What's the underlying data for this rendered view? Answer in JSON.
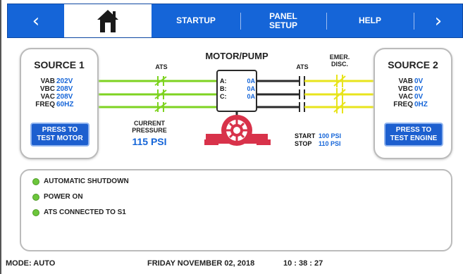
{
  "nav": {
    "back_arrow": "‹",
    "home_icon": "home-icon",
    "startup": "STARTUP",
    "panel_setup_line1": "PANEL",
    "panel_setup_line2": "SETUP",
    "help": "HELP",
    "forward_arrow": "›"
  },
  "source1": {
    "title": "SOURCE 1",
    "readings": [
      {
        "label": "VAB",
        "value": "202V"
      },
      {
        "label": "VBC",
        "value": "208V"
      },
      {
        "label": "VAC",
        "value": "208V"
      },
      {
        "label": "FREQ",
        "value": "60HZ"
      }
    ],
    "button_line1": "PRESS TO",
    "button_line2": "TEST MOTOR"
  },
  "source2": {
    "title": "SOURCE 2",
    "readings": [
      {
        "label": "VAB",
        "value": "0V"
      },
      {
        "label": "VBC",
        "value": "0V"
      },
      {
        "label": "VAC",
        "value": "0V"
      },
      {
        "label": "FREQ",
        "value": "0HZ"
      }
    ],
    "button_line1": "PRESS TO",
    "button_line2": "TEST ENGINE"
  },
  "diagram": {
    "motor_title": "MOTOR/PUMP",
    "ats_left": "ATS",
    "ats_right": "ATS",
    "emer_line1": "EMER.",
    "emer_line2": "DISC.",
    "phase_a_label": "A:",
    "phase_a_value": "0A",
    "phase_b_label": "B:",
    "phase_b_value": "0A",
    "phase_c_label": "C:",
    "phase_c_value": "0A",
    "current_line1": "CURRENT",
    "current_line2": "PRESSURE",
    "pressure_value": "115 PSI",
    "start_label": "START",
    "start_value": "100 PSI",
    "stop_label": "STOP",
    "stop_value": "110 PSI"
  },
  "status": [
    {
      "text": "AUTOMATIC SHUTDOWN"
    },
    {
      "text": "POWER ON"
    },
    {
      "text": "ATS CONNECTED TO S1"
    }
  ],
  "footer": {
    "mode": "MODE: AUTO",
    "date": "FRIDAY NOVEMBER 02, 2018",
    "time": "10 : 38 : 27"
  },
  "colors": {
    "nav_blue": "#1565d8",
    "source1_line": "#7ed321",
    "source2_line": "#e8e41c",
    "pump_red": "#d8324a",
    "led_green": "#6cc63b"
  }
}
